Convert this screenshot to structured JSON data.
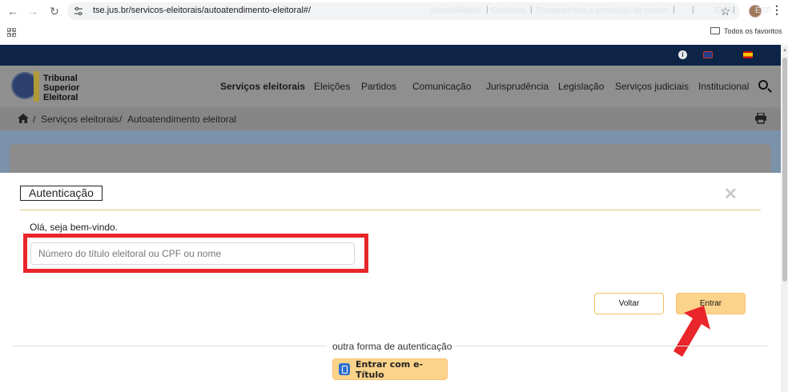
{
  "browser": {
    "url": "tse.jus.br/servicos-eleitorais/autoatendimento-eleitoral#/",
    "bookmarks_label": "Todos os favoritos"
  },
  "topbar": {
    "links": [
      "Acessibilidade",
      "Ouvidoria",
      "Transparência e prestação de contas"
    ],
    "separators": [
      "|",
      "|",
      "|"
    ],
    "lang_separator": "|",
    "lang_eng": "ENG",
    "lang_eng_sep": "|",
    "lang_esp": "ESP"
  },
  "logo": {
    "line1": "Tribunal",
    "line2": "Superior",
    "line3": "Eleitoral"
  },
  "nav": {
    "items": [
      "Serviços eleitorais",
      "Eleições",
      "Partidos",
      "Comunicação",
      "Jurisprudência",
      "Legislação",
      "Serviços judiciais",
      "Institucional"
    ]
  },
  "breadcrumb": {
    "sep1": "/",
    "item1": "Serviços eleitorais",
    "sep2": "/",
    "item2": "Autoatendimento eleitoral"
  },
  "modal": {
    "title": "Autenticação",
    "close": "✕",
    "welcome": "Olá, seja bem-vindo.",
    "input_placeholder": "Número do título eleitoral ou CPF ou nome",
    "input_value": "",
    "voltar_label": "Voltar",
    "entrar_label": "Entrar",
    "alt_label": "outra forma de autenticação",
    "etitulo_label": "Entrar com e-Título"
  },
  "colors": {
    "topbar": "#0d2446",
    "accent": "#fcd38a",
    "highlight": "#e8262b"
  }
}
